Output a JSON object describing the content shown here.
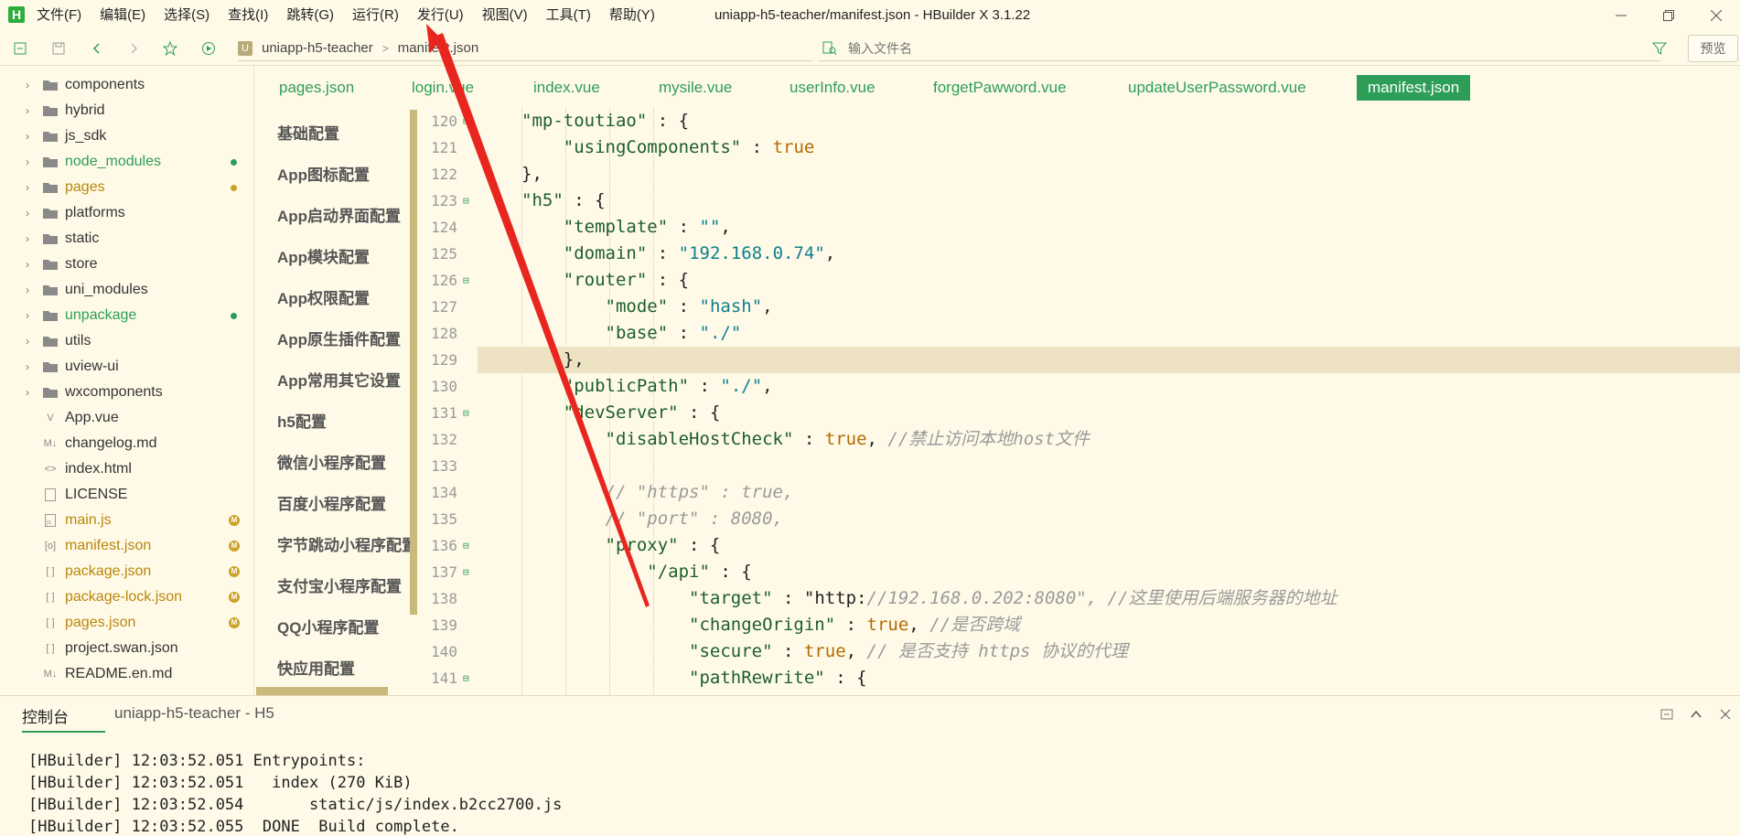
{
  "app": {
    "logo": "H",
    "window_title": "uniapp-h5-teacher/manifest.json - HBuilder X 3.1.22"
  },
  "menu": [
    "文件(F)",
    "编辑(E)",
    "选择(S)",
    "查找(I)",
    "跳转(G)",
    "运行(R)",
    "发行(U)",
    "视图(V)",
    "工具(T)",
    "帮助(Y)"
  ],
  "toolbar": {
    "project_badge": "U",
    "breadcrumb_project": "uniapp-h5-teacher",
    "breadcrumb_file": "manifest.json",
    "file_search_placeholder": "输入文件名",
    "preview_label": "预览"
  },
  "file_tree": [
    {
      "name": "components",
      "type": "folder"
    },
    {
      "name": "hybrid",
      "type": "folder"
    },
    {
      "name": "js_sdk",
      "type": "folder"
    },
    {
      "name": "node_modules",
      "type": "folder",
      "status": "green-dot"
    },
    {
      "name": "pages",
      "type": "folder",
      "status": "yellow-dot"
    },
    {
      "name": "platforms",
      "type": "folder"
    },
    {
      "name": "static",
      "type": "folder"
    },
    {
      "name": "store",
      "type": "folder"
    },
    {
      "name": "uni_modules",
      "type": "folder"
    },
    {
      "name": "unpackage",
      "type": "folder",
      "status": "green-dot"
    },
    {
      "name": "utils",
      "type": "folder"
    },
    {
      "name": "uview-ui",
      "type": "folder"
    },
    {
      "name": "wxcomponents",
      "type": "folder"
    },
    {
      "name": "App.vue",
      "type": "file",
      "icon": "V"
    },
    {
      "name": "changelog.md",
      "type": "file",
      "icon": "M↓"
    },
    {
      "name": "index.html",
      "type": "file",
      "icon": "<>"
    },
    {
      "name": "LICENSE",
      "type": "file",
      "icon": "blank"
    },
    {
      "name": "main.js",
      "type": "file",
      "icon": "js",
      "status": "M"
    },
    {
      "name": "manifest.json",
      "type": "file",
      "icon": "json",
      "status": "M"
    },
    {
      "name": "package.json",
      "type": "file",
      "icon": "[ ]",
      "status": "M"
    },
    {
      "name": "package-lock.json",
      "type": "file",
      "icon": "[ ]",
      "status": "M"
    },
    {
      "name": "pages.json",
      "type": "file",
      "icon": "[ ]",
      "status": "M"
    },
    {
      "name": "project.swan.json",
      "type": "file",
      "icon": "[ ]"
    },
    {
      "name": "README.en.md",
      "type": "file",
      "icon": "M↓"
    }
  ],
  "settings_nav": [
    "基础配置",
    "App图标配置",
    "App启动界面配置",
    "App模块配置",
    "App权限配置",
    "App原生插件配置",
    "App常用其它设置",
    "h5配置",
    "微信小程序配置",
    "百度小程序配置",
    "字节跳动小程序配置",
    "支付宝小程序配置",
    "QQ小程序配置",
    "快应用配置"
  ],
  "tabs": [
    "pages.json",
    "login.vue",
    "index.vue",
    "mysile.vue",
    "userInfo.vue",
    "forgetPawword.vue",
    "updateUserPassword.vue",
    "manifest.json"
  ],
  "active_tab": "manifest.json",
  "code": {
    "current_line": 129,
    "lines": [
      {
        "n": "120",
        "fold": true,
        "text": "\"mp-toutiao\" : {"
      },
      {
        "n": "121",
        "fold": false,
        "text": "    \"usingComponents\" : true"
      },
      {
        "n": "122",
        "fold": false,
        "text": "},"
      },
      {
        "n": "123",
        "fold": true,
        "text": "\"h5\" : {"
      },
      {
        "n": "124",
        "fold": false,
        "text": "    \"template\" : \"\","
      },
      {
        "n": "125",
        "fold": false,
        "text": "    \"domain\" : \"192.168.0.74\","
      },
      {
        "n": "126",
        "fold": true,
        "text": "    \"router\" : {"
      },
      {
        "n": "127",
        "fold": false,
        "text": "        \"mode\" : \"hash\","
      },
      {
        "n": "128",
        "fold": false,
        "text": "        \"base\" : \"./\""
      },
      {
        "n": "129",
        "fold": false,
        "text": "    },"
      },
      {
        "n": "130",
        "fold": false,
        "text": "    \"publicPath\" : \"./\","
      },
      {
        "n": "131",
        "fold": true,
        "text": "    \"devServer\" : {"
      },
      {
        "n": "132",
        "fold": false,
        "text": "        \"disableHostCheck\" : true, //禁止访问本地host文件"
      },
      {
        "n": "133",
        "fold": false,
        "text": ""
      },
      {
        "n": "134",
        "fold": false,
        "text": "        // \"https\" : true,"
      },
      {
        "n": "135",
        "fold": false,
        "text": "        // \"port\" : 8080,"
      },
      {
        "n": "136",
        "fold": true,
        "text": "        \"proxy\" : {"
      },
      {
        "n": "137",
        "fold": true,
        "text": "            \"/api\" : {"
      },
      {
        "n": "138",
        "fold": false,
        "text": "                \"target\" : \"http://192.168.0.202:8080\", //这里使用后端服务器的地址"
      },
      {
        "n": "139",
        "fold": false,
        "text": "                \"changeOrigin\" : true, //是否跨域"
      },
      {
        "n": "140",
        "fold": false,
        "text": "                \"secure\" : true, // 是否支持 https 协议的代理"
      },
      {
        "n": "141",
        "fold": true,
        "text": "                \"pathRewrite\" : {"
      }
    ]
  },
  "console": {
    "tabs": [
      "控制台",
      "uniapp-h5-teacher - H5"
    ],
    "lines": [
      "[HBuilder] 12:03:52.051 Entrypoints:",
      "[HBuilder] 12:03:52.051   index (270 KiB)",
      "[HBuilder] 12:03:52.054       static/js/index.b2cc2700.js",
      "[HBuilder] 12:03:52.055  DONE  Build complete."
    ]
  },
  "colors": {
    "background": "#fffae8",
    "accent": "#2d9e57",
    "annotation_arrow": "#e8251f"
  }
}
